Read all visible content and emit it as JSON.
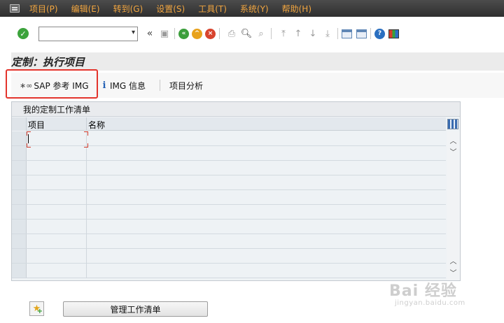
{
  "menu": {
    "items": [
      {
        "label": "项目(P)"
      },
      {
        "label": "编辑(E)"
      },
      {
        "label": "转到(G)"
      },
      {
        "label": "设置(S)"
      },
      {
        "label": "工具(T)"
      },
      {
        "label": "系统(Y)"
      },
      {
        "label": "帮助(H)"
      }
    ],
    "accent_color": "#f2a640"
  },
  "toolbar": {
    "command_field_value": "",
    "icons": [
      "enter-check-icon",
      "save-icon",
      "back-icon",
      "exit-icon",
      "cancel-icon",
      "print-icon",
      "find-icon",
      "find-next-icon",
      "first-page-icon",
      "previous-page-icon",
      "next-page-icon",
      "last-page-icon",
      "create-session-icon",
      "shortcut-icon",
      "help-icon",
      "customize-layout-icon"
    ]
  },
  "title": {
    "text": "定制：执行项目"
  },
  "app_toolbar": {
    "sap_ref_img_label": "SAP 参考 IMG",
    "img_info_label": "IMG 信息",
    "project_analysis_label": "项目分析",
    "highlight_color": "#e3342c"
  },
  "worklist": {
    "title": "我的定制工作清单",
    "columns": [
      "项目",
      "名称"
    ],
    "rows": []
  },
  "bottom": {
    "manage_worklist_label": "管理工作清单"
  },
  "watermark": {
    "main": "Bai 经验",
    "sub": "jingyan.baidu.com"
  }
}
